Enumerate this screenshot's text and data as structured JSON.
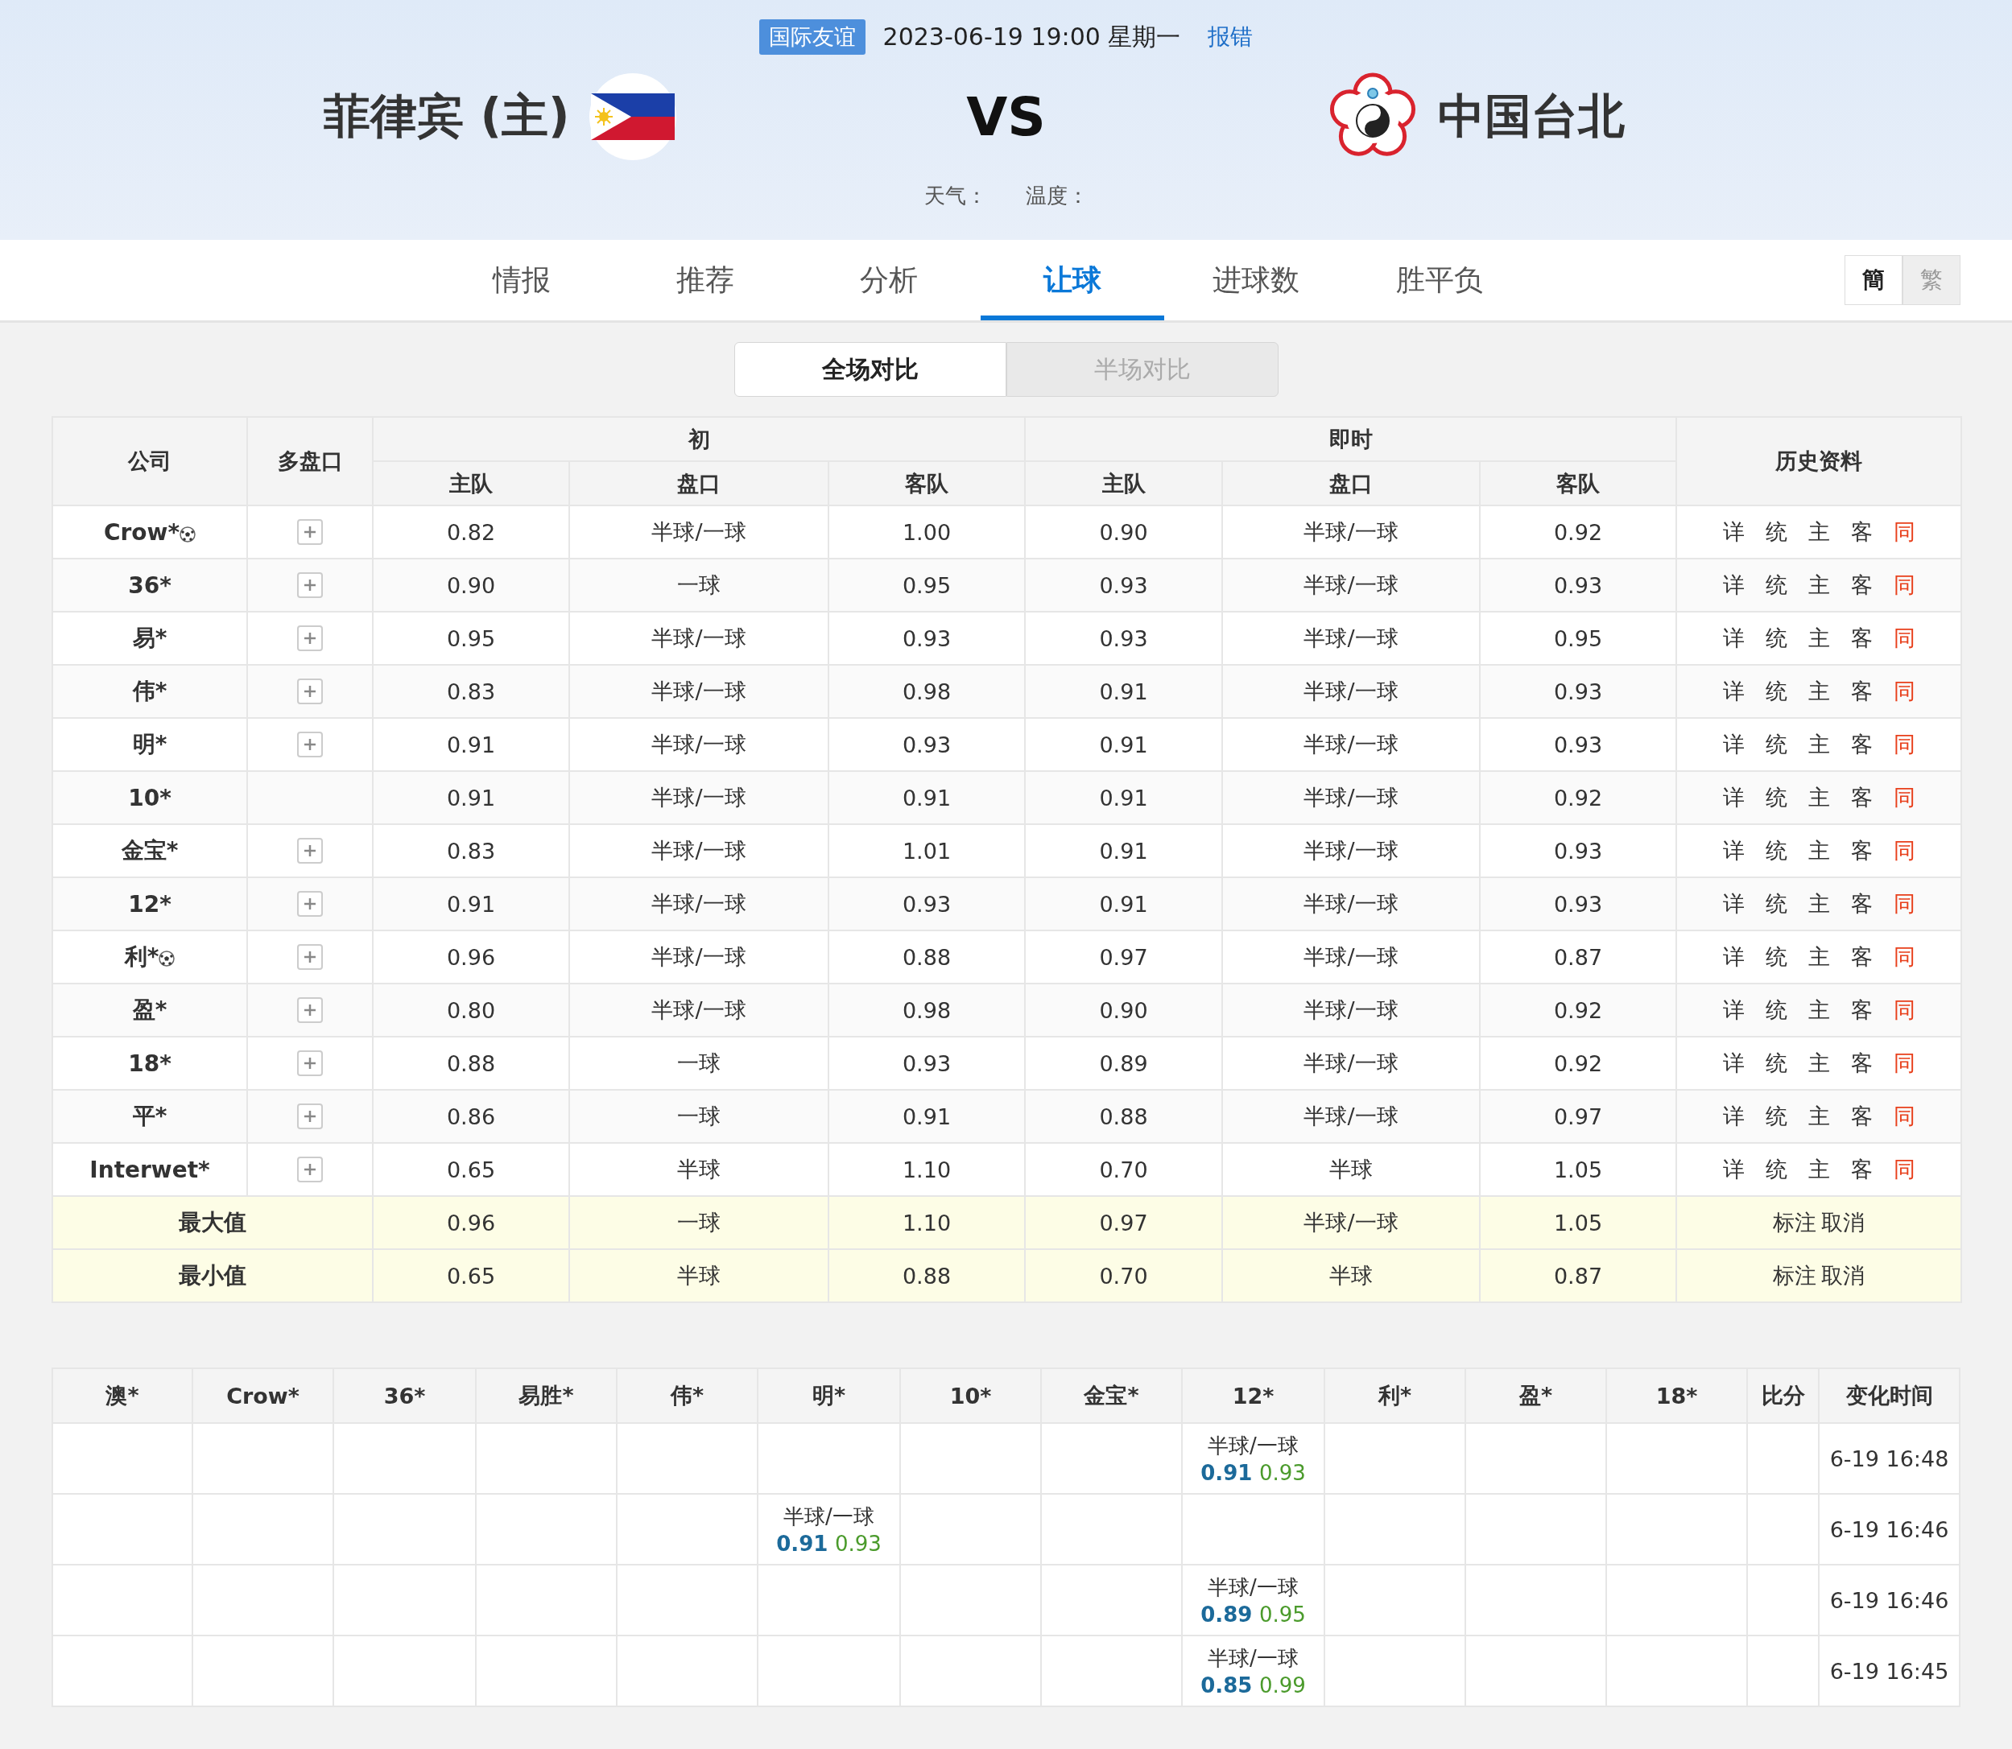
{
  "header": {
    "league": "国际友谊",
    "datetime": "2023-06-19 19:00 星期一",
    "report_link": "报错",
    "home_team": "菲律宾 (主)",
    "vs": "VS",
    "away_team": "中国台北",
    "weather_label": "天气：",
    "temperature_label": "温度："
  },
  "tabs": [
    {
      "label": "情报",
      "selected": false
    },
    {
      "label": "推荐",
      "selected": false
    },
    {
      "label": "分析",
      "selected": false
    },
    {
      "label": "让球",
      "selected": true
    },
    {
      "label": "进球数",
      "selected": false
    },
    {
      "label": "胜平负",
      "selected": false
    }
  ],
  "script_switch": [
    {
      "label": "簡",
      "selected": true
    },
    {
      "label": "繁",
      "selected": false
    }
  ],
  "compare_toggle": [
    {
      "label": "全场对比",
      "selected": true
    },
    {
      "label": "半场对比",
      "selected": false
    }
  ],
  "odds_table": {
    "company_header": "公司",
    "multi_header": "多盘口",
    "initial_header": "初",
    "live_header": "即时",
    "history_header": "历史资料",
    "initial_sub_columns": [
      "主队",
      "盘口",
      "客队"
    ],
    "live_sub_columns": [
      "主队",
      "盘口",
      "客队"
    ],
    "rows": [
      {
        "company": "Crow*",
        "ball_icon": true,
        "multi": true,
        "initial": [
          "0.82",
          "半球/一球",
          "1.00"
        ],
        "live": [
          "0.90",
          "半球/一球",
          "0.92"
        ],
        "history": [
          "详",
          "统",
          "主",
          "客",
          "同"
        ]
      },
      {
        "company": "36*",
        "ball_icon": false,
        "multi": true,
        "initial": [
          "0.90",
          "一球",
          "0.95"
        ],
        "live": [
          "0.93",
          "半球/一球",
          "0.93"
        ],
        "history": [
          "详",
          "统",
          "主",
          "客",
          "同"
        ]
      },
      {
        "company": "易*",
        "ball_icon": false,
        "multi": true,
        "initial": [
          "0.95",
          "半球/一球",
          "0.93"
        ],
        "live": [
          "0.93",
          "半球/一球",
          "0.95"
        ],
        "history": [
          "详",
          "统",
          "主",
          "客",
          "同"
        ]
      },
      {
        "company": "伟*",
        "ball_icon": false,
        "multi": true,
        "initial": [
          "0.83",
          "半球/一球",
          "0.98"
        ],
        "live": [
          "0.91",
          "半球/一球",
          "0.93"
        ],
        "history": [
          "详",
          "统",
          "主",
          "客",
          "同"
        ]
      },
      {
        "company": "明*",
        "ball_icon": false,
        "multi": true,
        "initial": [
          "0.91",
          "半球/一球",
          "0.93"
        ],
        "live": [
          "0.91",
          "半球/一球",
          "0.93"
        ],
        "history": [
          "详",
          "统",
          "主",
          "客",
          "同"
        ]
      },
      {
        "company": "10*",
        "ball_icon": false,
        "multi": false,
        "initial": [
          "0.91",
          "半球/一球",
          "0.91"
        ],
        "live": [
          "0.91",
          "半球/一球",
          "0.92"
        ],
        "history": [
          "详",
          "统",
          "主",
          "客",
          "同"
        ]
      },
      {
        "company": "金宝*",
        "ball_icon": false,
        "multi": true,
        "initial": [
          "0.83",
          "半球/一球",
          "1.01"
        ],
        "live": [
          "0.91",
          "半球/一球",
          "0.93"
        ],
        "history": [
          "详",
          "统",
          "主",
          "客",
          "同"
        ]
      },
      {
        "company": "12*",
        "ball_icon": false,
        "multi": true,
        "initial": [
          "0.91",
          "半球/一球",
          "0.93"
        ],
        "live": [
          "0.91",
          "半球/一球",
          "0.93"
        ],
        "history": [
          "详",
          "统",
          "主",
          "客",
          "同"
        ]
      },
      {
        "company": "利*",
        "ball_icon": true,
        "multi": true,
        "initial": [
          "0.96",
          "半球/一球",
          "0.88"
        ],
        "live": [
          "0.97",
          "半球/一球",
          "0.87"
        ],
        "history": [
          "详",
          "统",
          "主",
          "客",
          "同"
        ]
      },
      {
        "company": "盈*",
        "ball_icon": false,
        "multi": true,
        "initial": [
          "0.80",
          "半球/一球",
          "0.98"
        ],
        "live": [
          "0.90",
          "半球/一球",
          "0.92"
        ],
        "history": [
          "详",
          "统",
          "主",
          "客",
          "同"
        ]
      },
      {
        "company": "18*",
        "ball_icon": false,
        "multi": true,
        "initial": [
          "0.88",
          "一球",
          "0.93"
        ],
        "live": [
          "0.89",
          "半球/一球",
          "0.92"
        ],
        "history": [
          "详",
          "统",
          "主",
          "客",
          "同"
        ]
      },
      {
        "company": "平*",
        "ball_icon": false,
        "multi": true,
        "initial": [
          "0.86",
          "一球",
          "0.91"
        ],
        "live": [
          "0.88",
          "半球/一球",
          "0.97"
        ],
        "history": [
          "详",
          "统",
          "主",
          "客",
          "同"
        ]
      },
      {
        "company": "Interwet*",
        "ball_icon": false,
        "multi": true,
        "initial": [
          "0.65",
          "半球",
          "1.10"
        ],
        "live": [
          "0.70",
          "半球",
          "1.05"
        ],
        "history": [
          "详",
          "统",
          "主",
          "客",
          "同"
        ]
      }
    ],
    "summary_rows": [
      {
        "label": "最大值",
        "initial": [
          "0.96",
          "一球",
          "1.10"
        ],
        "live": [
          "0.97",
          "半球/一球",
          "1.05"
        ],
        "actions": [
          "标注",
          "取消"
        ]
      },
      {
        "label": "最小值",
        "initial": [
          "0.65",
          "半球",
          "0.88"
        ],
        "live": [
          "0.70",
          "半球",
          "0.87"
        ],
        "actions": [
          "标注",
          "取消"
        ]
      }
    ]
  },
  "changes_table": {
    "columns": [
      "澳*",
      "Crow*",
      "36*",
      "易胜*",
      "伟*",
      "明*",
      "10*",
      "金宝*",
      "12*",
      "利*",
      "盈*",
      "18*",
      "比分",
      "变化时间"
    ],
    "rows": [
      {
        "cells": [
          null,
          null,
          null,
          null,
          null,
          null,
          null,
          null,
          {
            "line": "半球/一球",
            "home": "0.91",
            "away": "0.93"
          },
          null,
          null,
          null,
          null
        ],
        "time": "6-19 16:48"
      },
      {
        "cells": [
          null,
          null,
          null,
          null,
          null,
          {
            "line": "半球/一球",
            "home": "0.91",
            "away": "0.93"
          },
          null,
          null,
          null,
          null,
          null,
          null,
          null
        ],
        "time": "6-19 16:46"
      },
      {
        "cells": [
          null,
          null,
          null,
          null,
          null,
          null,
          null,
          null,
          {
            "line": "半球/一球",
            "home": "0.89",
            "away": "0.95"
          },
          null,
          null,
          null,
          null
        ],
        "time": "6-19 16:46"
      },
      {
        "cells": [
          null,
          null,
          null,
          null,
          null,
          null,
          null,
          null,
          {
            "line": "半球/一球",
            "home": "0.85",
            "away": "0.99"
          },
          null,
          null,
          null,
          null
        ],
        "time": "6-19 16:45"
      }
    ]
  }
}
